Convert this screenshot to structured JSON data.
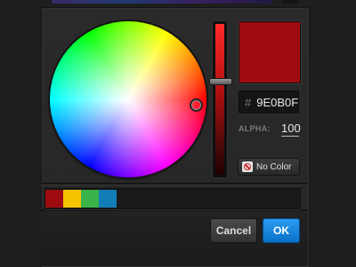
{
  "color": {
    "hex_prefix": "#",
    "hex_value": "9E0B0F",
    "alpha_label": "ALPHA:",
    "alpha_value": "100",
    "selected_hex": "#9e0b0f"
  },
  "no_color_button": {
    "label": "No Color",
    "icon": "no-color-icon"
  },
  "swatches": [
    {
      "color": "#9e0b0f"
    },
    {
      "color": "#f5c400"
    },
    {
      "color": "#3cb24a"
    },
    {
      "color": "#137db8"
    }
  ],
  "footer": {
    "cancel_label": "Cancel",
    "ok_label": "OK"
  },
  "colors": {
    "accent": "#1a88e0",
    "panel": "#262626"
  }
}
